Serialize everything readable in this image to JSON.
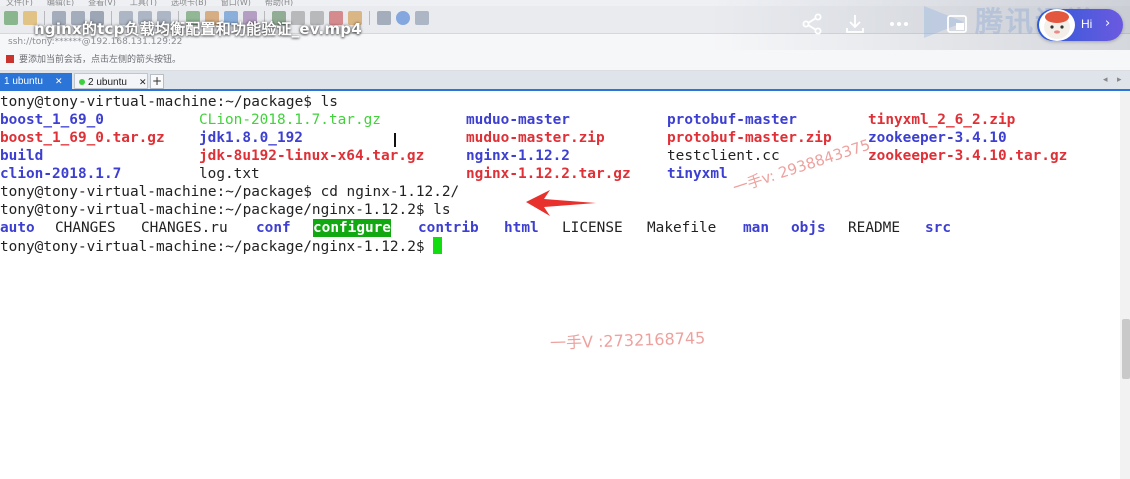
{
  "window": {
    "menu": [
      "文件(F)",
      "编辑(E)",
      "查看(V)",
      "工具(T)",
      "选项卡(B)",
      "窗口(W)",
      "帮助(H)"
    ],
    "address": "ssh://tony:******@192.168.131.129:22",
    "hint": "要添加当前会话，点击左侧的箭头按钮。"
  },
  "video_overlay": {
    "title": "nginx的tcp负载均衡配置和功能验证_ev.mp4",
    "brand": "腾讯课堂",
    "hi_label": "Hi",
    "icons": [
      "share-icon",
      "download-icon",
      "more-icon",
      "picture-in-picture-icon"
    ]
  },
  "tabs": [
    {
      "label": "1 ubuntu",
      "active": true,
      "dot_color": "#3ecf3e"
    },
    {
      "label": "2 ubuntu",
      "active": false,
      "dot_color": "#3ecf3e"
    }
  ],
  "terminal": {
    "lines": [
      {
        "kind": "cmd",
        "prompt": "tony@tony-virtual-machine:~/package$",
        "command": " ls"
      },
      {
        "kind": "ls",
        "cells": [
          {
            "text": "boost_1_69_0",
            "type": "dir"
          },
          {
            "text": "CLion-2018.1.7.tar.gz",
            "type": "exe"
          },
          {
            "text": "muduo-master",
            "type": "dir"
          },
          {
            "text": "protobuf-master",
            "type": "dir"
          },
          {
            "text": "tinyxml_2_6_2.zip",
            "type": "arch"
          }
        ]
      },
      {
        "kind": "ls",
        "cells": [
          {
            "text": "boost_1_69_0.tar.gz",
            "type": "arch"
          },
          {
            "text": "jdk1.8.0_192",
            "type": "dir"
          },
          {
            "text": "muduo-master.zip",
            "type": "arch"
          },
          {
            "text": "protobuf-master.zip",
            "type": "arch"
          },
          {
            "text": "zookeeper-3.4.10",
            "type": "dir"
          }
        ]
      },
      {
        "kind": "ls",
        "cells": [
          {
            "text": "build",
            "type": "dir"
          },
          {
            "text": "jdk-8u192-linux-x64.tar.gz",
            "type": "arch"
          },
          {
            "text": "nginx-1.12.2",
            "type": "dir"
          },
          {
            "text": "testclient.cc",
            "type": "plain"
          },
          {
            "text": "zookeeper-3.4.10.tar.gz",
            "type": "arch"
          }
        ]
      },
      {
        "kind": "ls",
        "cells": [
          {
            "text": "clion-2018.1.7",
            "type": "dir"
          },
          {
            "text": "log.txt",
            "type": "plain"
          },
          {
            "text": "nginx-1.12.2.tar.gz",
            "type": "arch"
          },
          {
            "text": "tinyxml",
            "type": "dir"
          },
          {
            "text": "",
            "type": "plain"
          }
        ]
      },
      {
        "kind": "cmd",
        "prompt": "tony@tony-virtual-machine:~/package$",
        "command": " cd nginx-1.12.2/"
      },
      {
        "kind": "cmd",
        "prompt": "tony@tony-virtual-machine:~/package/nginx-1.12.2$",
        "command": " ls"
      },
      {
        "kind": "flow",
        "items": [
          {
            "text": "auto",
            "type": "dir"
          },
          {
            "text": "CHANGES",
            "type": "plain"
          },
          {
            "text": "CHANGES.ru",
            "type": "plain"
          },
          {
            "text": "conf",
            "type": "dir"
          },
          {
            "text": "configure",
            "type": "hl"
          },
          {
            "text": "contrib",
            "type": "dir"
          },
          {
            "text": "html",
            "type": "dir"
          },
          {
            "text": "LICENSE",
            "type": "plain"
          },
          {
            "text": "Makefile",
            "type": "plain"
          },
          {
            "text": "man",
            "type": "dir"
          },
          {
            "text": "objs",
            "type": "dir"
          },
          {
            "text": "README",
            "type": "plain"
          },
          {
            "text": "src",
            "type": "dir"
          }
        ]
      },
      {
        "kind": "prompt_cursor",
        "prompt": "tony@tony-virtual-machine:~/package/nginx-1.12.2$",
        "command": " "
      }
    ]
  },
  "annotations": {
    "watermark_1": "一手v: 2938843375",
    "watermark_2": "一手V :2732168745",
    "arrow_color": "#e8312c"
  },
  "colors": {
    "directory": "#3d3fd0",
    "archive": "#de3036",
    "executable": "#42d23c",
    "highlight_bg": "#11a811",
    "cursor": "#11dd11",
    "tab_active": "#2b74d8"
  }
}
